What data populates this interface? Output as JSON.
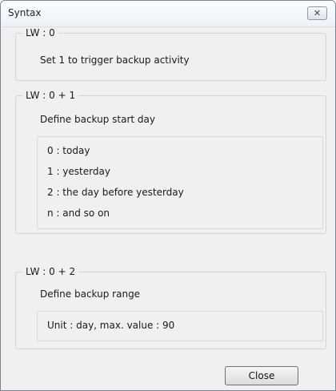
{
  "window": {
    "title": "Syntax",
    "close_glyph": "✕"
  },
  "groups": [
    {
      "label": "LW : 0",
      "text": "Set 1 to trigger backup activity"
    },
    {
      "label": "LW : 0 + 1",
      "text": "Define backup start day",
      "lines": [
        "0 : today",
        "1 : yesterday",
        "2 : the day before yesterday",
        "n : and so on"
      ]
    },
    {
      "label": "LW : 0 + 2",
      "text": "Define backup range",
      "lines": [
        "Unit : day, max. value : 90"
      ]
    }
  ],
  "buttons": {
    "close": "Close"
  }
}
